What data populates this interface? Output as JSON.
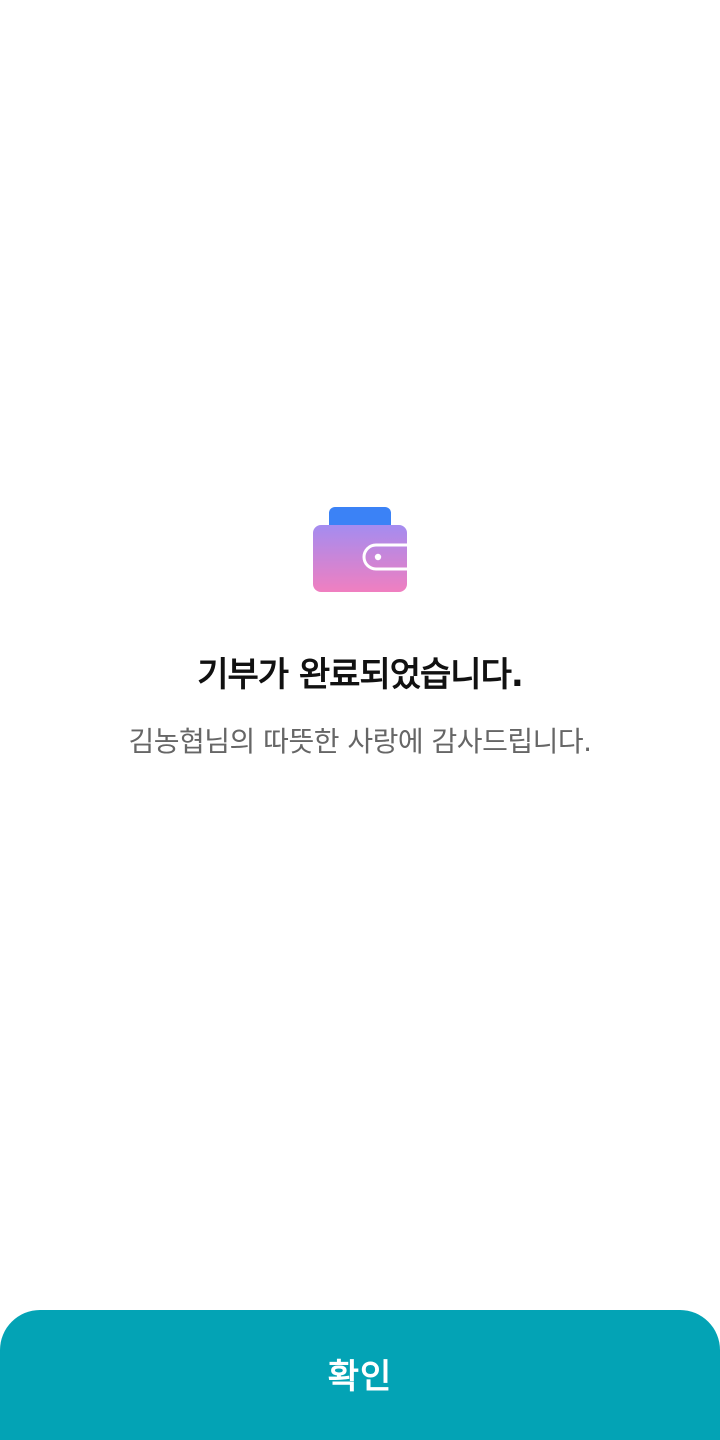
{
  "result": {
    "icon": "wallet-icon",
    "title": "기부가 완료되었습니다.",
    "subtitle": "김농협님의 따뜻한 사랑에 감사드립니다."
  },
  "footer": {
    "confirm_label": "확인"
  },
  "colors": {
    "background": "#ffffff",
    "title": "#111111",
    "subtitle": "#666666",
    "button": "#03a3b5",
    "button_text": "#ffffff",
    "wallet_card": "#3b82f6",
    "wallet_gradient_top": "#a78bfa",
    "wallet_gradient_bottom": "#f472b6"
  }
}
